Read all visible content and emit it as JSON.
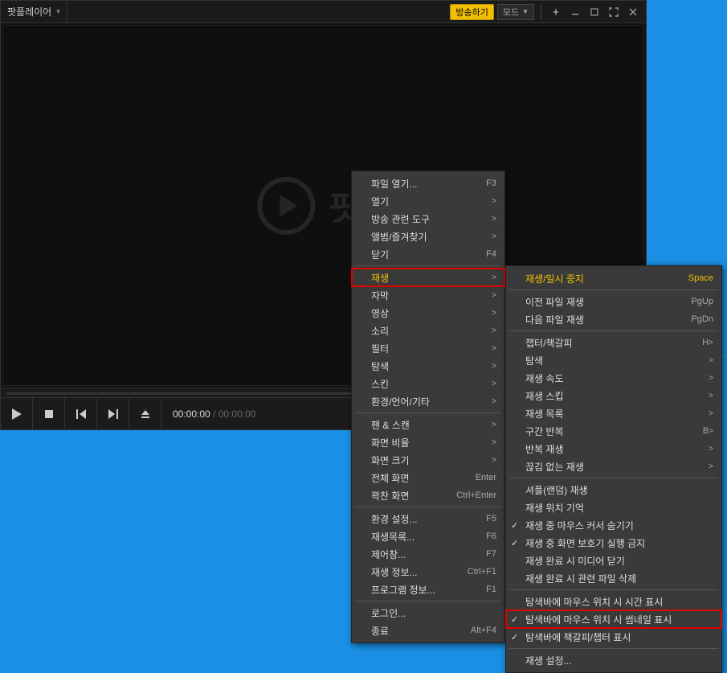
{
  "title": "팟플레이어",
  "broadcast_btn": "방송하기",
  "mode_btn": "모드",
  "logo_text": "팟플",
  "time_current": "00:00:00",
  "time_total": "00:00:00",
  "menu1": {
    "items": [
      {
        "label": "파일 열기...",
        "shortcut": "F3"
      },
      {
        "label": "열기",
        "sub": true
      },
      {
        "label": "방송 관련 도구",
        "sub": true
      },
      {
        "label": "앨범/즐겨찾기",
        "sub": true
      },
      {
        "label": "닫기",
        "shortcut": "F4"
      }
    ],
    "items2": [
      {
        "label": "재생",
        "sub": true,
        "highlight": true,
        "boxed": true
      },
      {
        "label": "자막",
        "sub": true
      },
      {
        "label": "영상",
        "sub": true
      },
      {
        "label": "소리",
        "sub": true
      },
      {
        "label": "필터",
        "sub": true
      },
      {
        "label": "탐색",
        "sub": true
      },
      {
        "label": "스킨",
        "sub": true
      },
      {
        "label": "환경/언어/기타",
        "sub": true
      }
    ],
    "items3": [
      {
        "label": "팬 & 스캔",
        "sub": true
      },
      {
        "label": "화면 비율",
        "sub": true
      },
      {
        "label": "화면 크기",
        "sub": true
      },
      {
        "label": "전체 화면",
        "shortcut": "Enter"
      },
      {
        "label": "꽉찬 화면",
        "shortcut": "Ctrl+Enter"
      }
    ],
    "items4": [
      {
        "label": "환경 설정...",
        "shortcut": "F5"
      },
      {
        "label": "재생목록...",
        "shortcut": "F6"
      },
      {
        "label": "제어창...",
        "shortcut": "F7"
      },
      {
        "label": "재생 정보...",
        "shortcut": "Ctrl+F1"
      },
      {
        "label": "프로그램 정보...",
        "shortcut": "F1"
      }
    ],
    "items5": [
      {
        "label": "로그인..."
      },
      {
        "label": "종료",
        "shortcut": "Alt+F4"
      }
    ]
  },
  "menu2": {
    "groups": [
      [
        {
          "label": "재생/일시 중지",
          "shortcut": "Space",
          "highlight": true
        }
      ],
      [
        {
          "label": "이전 파일 재생",
          "shortcut": "PgUp"
        },
        {
          "label": "다음 파일 재생",
          "shortcut": "PgDn"
        }
      ],
      [
        {
          "label": "챕터/책갈피",
          "shortcut": "H",
          "sub": true
        },
        {
          "label": "탐색",
          "sub": true
        },
        {
          "label": "재생 속도",
          "sub": true
        },
        {
          "label": "재생 스킵",
          "sub": true
        },
        {
          "label": "재생 목록",
          "sub": true
        },
        {
          "label": "구간 반복",
          "shortcut": "B",
          "sub": true
        },
        {
          "label": "반복 재생",
          "sub": true
        },
        {
          "label": "끊김 없는 재생",
          "sub": true
        }
      ],
      [
        {
          "label": "셔플(랜덤) 재생"
        },
        {
          "label": "재생 위치 기억"
        },
        {
          "label": "재생 중 마우스 커서 숨기기",
          "checked": true
        },
        {
          "label": "재생 중 화면 보호기 실행 금지",
          "checked": true
        },
        {
          "label": "재생 완료 시 미디어 닫기"
        },
        {
          "label": "재생 완료 시 관련 파일 삭제"
        }
      ],
      [
        {
          "label": "탐색바에 마우스 위치 시 시간 표시"
        },
        {
          "label": "탐색바에 마우스 위치 시 썸네일 표시",
          "checked": true,
          "boxed": true
        },
        {
          "label": "탐색바에 책갈피/챕터 표시",
          "checked": true
        }
      ],
      [
        {
          "label": "재생 설정..."
        }
      ]
    ]
  }
}
